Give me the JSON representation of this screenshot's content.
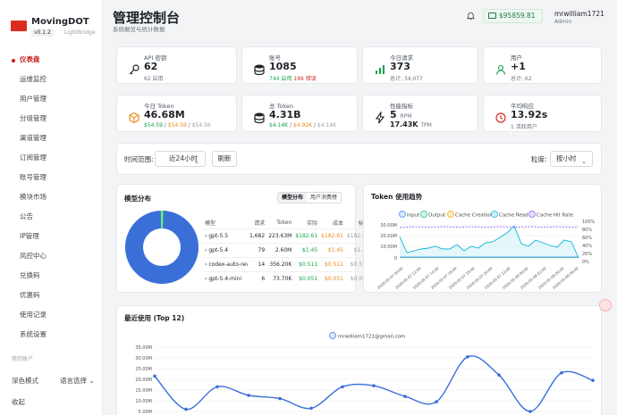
{
  "brand": {
    "name": "MovingDOT",
    "version": "v0.1.2",
    "sub": "LightBridge"
  },
  "nav": [
    "仪表盘",
    "运维监控",
    "用户管理",
    "分组管理",
    "渠道管理",
    "订阅管理",
    "账号管理",
    "模块市场",
    "公告",
    "IP管理",
    "风控中心",
    "兑换码",
    "优惠码",
    "使用记录",
    "系统设置"
  ],
  "sidebar_bottom": {
    "section": "我的账户",
    "dark_mode": "深色模式",
    "language": "语言选择",
    "logout": "收起"
  },
  "header": {
    "title": "管理控制台",
    "subtitle": "系统概览与统计数据",
    "balance": "$95859.81",
    "user": "mrwilliam1721",
    "role": "Admin"
  },
  "stats_row1": [
    {
      "label": "API 密钥",
      "value": "62",
      "sub": "62 启用"
    },
    {
      "label": "账号",
      "value": "1085",
      "sub_ok": "744 启用",
      "sub_err": "199 错误"
    },
    {
      "label": "今日请求",
      "value": "373",
      "sub": "总计: 34,077"
    },
    {
      "label": "用户",
      "value": "+1",
      "sub": "总计: 62"
    }
  ],
  "stats_row2": [
    {
      "label": "今日 Token",
      "value": "46.68M",
      "a": "$54.59",
      "b": "$54.59",
      "c": "$54.56"
    },
    {
      "label": "总 Token",
      "value": "4.31B",
      "a": "$4.14K",
      "b": "$4.92K",
      "c": "$4.14K"
    },
    {
      "label": "性能指标",
      "value": "5",
      "unit": "RPM",
      "value2": "17.43K",
      "unit2": "TPM"
    },
    {
      "label": "平均响应",
      "value": "13.92s",
      "sub": "1 活跃用户"
    }
  ],
  "filter": {
    "range_label": "时间范围:",
    "range_value": "近24小时",
    "refresh": "刷新",
    "gran_label": "粒度:",
    "gran_value": "按小时"
  },
  "model_dist": {
    "title": "模型分布",
    "tabs": [
      "模型分布",
      "用户消费榜"
    ],
    "headers": [
      "模型",
      "请求",
      "Token",
      "实际",
      "成本",
      "标准"
    ],
    "rows": [
      [
        "gpt-5.5",
        "1,682",
        "223.63M",
        "$182.61",
        "$182.61",
        "$182.61"
      ],
      [
        "gpt-5.4",
        "79",
        "2.60M",
        "$1.45",
        "$1.45",
        "$1.45"
      ],
      [
        "codex-auto-rev",
        "14",
        "356.20K",
        "$0.511",
        "$0.511",
        "$0.511"
      ],
      [
        "gpt-5.4-mini",
        "6",
        "73.70K",
        "$0.051",
        "$0.051",
        "$0.051"
      ]
    ]
  },
  "token_trend": {
    "title": "Token 使用趋势",
    "legend": [
      "Input",
      "Output",
      "Cache Creation",
      "Cache Read",
      "Cache Hit Rate"
    ],
    "colors": [
      "#3b82f6",
      "#10b981",
      "#f59e0b",
      "#06b6d4",
      "#8b5cf6"
    ],
    "y_left": [
      "30.00M",
      "20.00M",
      "10.00M",
      "0"
    ],
    "y_right": [
      "100%",
      "80%",
      "60%",
      "40%",
      "20%",
      "0%"
    ]
  },
  "recent": {
    "title": "最近使用 (Top 12)",
    "legend": "mrwilliam1721@gmail.com"
  },
  "chart_data": {
    "type": "line",
    "title": "最近使用 (Top 12)",
    "series": [
      {
        "name": "mrwilliam1721@gmail.com",
        "values": [
          21.5,
          6.0,
          16.5,
          12.5,
          11.0,
          6.5,
          16.5,
          17.0,
          12.0,
          9.5,
          30.5,
          22.0,
          5.0,
          23.0,
          19.5
        ]
      }
    ],
    "ylim": [
      0,
      35
    ],
    "yticks": [
      "35.00M",
      "30.00M",
      "25.00M",
      "20.00M",
      "15.00M",
      "10.00M",
      "5.00M"
    ],
    "grid": true,
    "color": "#3b6fd8"
  }
}
